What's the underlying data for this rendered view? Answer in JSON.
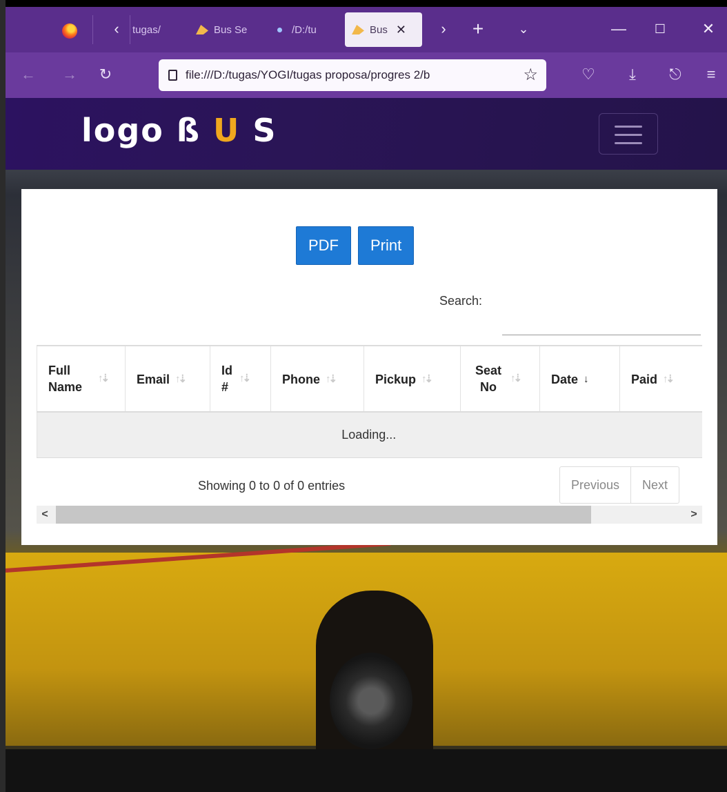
{
  "browser": {
    "tabs": [
      {
        "label": "tugas/"
      },
      {
        "label": "Bus Se"
      },
      {
        "label": "/D:/tu"
      },
      {
        "label": "Bus",
        "active": true
      }
    ],
    "url": "file:///D:/tugas/YOGI/tugas proposa/progres 2/b",
    "colors": {
      "tabbar": "#5a2e8c",
      "navbar": "#6a3a9d"
    }
  },
  "site": {
    "logo_text": "logo ß",
    "logo_accent": "U",
    "logo_tail": "S",
    "accent_color": "#f0a81e"
  },
  "toolbar": {
    "pdf_label": "PDF",
    "print_label": "Print"
  },
  "search": {
    "label": "Search:",
    "value": ""
  },
  "table": {
    "columns": [
      {
        "label": "Full Name",
        "sort": "none"
      },
      {
        "label": "Email",
        "sort": "none"
      },
      {
        "label": "Id #",
        "sort": "none"
      },
      {
        "label": "Phone",
        "sort": "none"
      },
      {
        "label": "Pickup",
        "sort": "none"
      },
      {
        "label": "Seat No",
        "sort": "none"
      },
      {
        "label": "Date",
        "sort": "desc"
      },
      {
        "label": "Paid",
        "sort": "none"
      }
    ],
    "loading_text": "Loading..."
  },
  "footer": {
    "info": "Showing 0 to 0 of 0 entries",
    "previous_label": "Previous",
    "next_label": "Next"
  },
  "scroll": {
    "left_arrow": "<",
    "right_arrow": ">"
  }
}
